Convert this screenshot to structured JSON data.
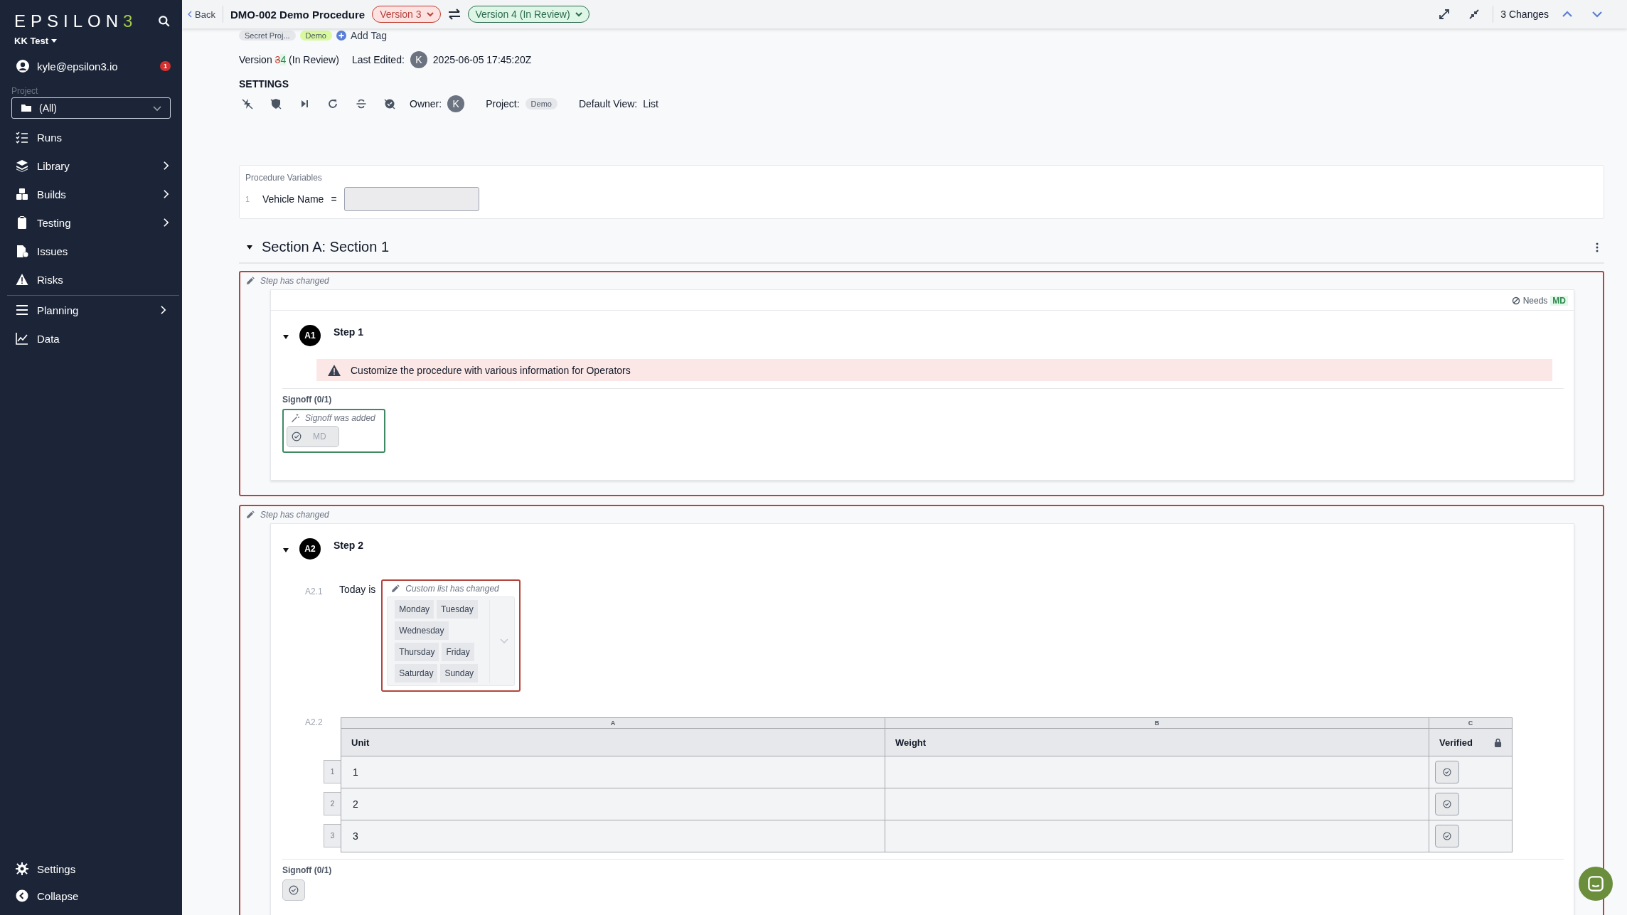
{
  "sidebar": {
    "logo": "EPSILON3",
    "workspace": "KK Test",
    "user": "kyle@epsilon3.io",
    "notifications": "1",
    "project_label": "Project",
    "project_value": "(All)",
    "nav": [
      {
        "label": "Runs",
        "submenu": false,
        "divider_before": false
      },
      {
        "label": "Library",
        "submenu": true,
        "divider_before": false
      },
      {
        "label": "Builds",
        "submenu": true,
        "divider_before": false
      },
      {
        "label": "Testing",
        "submenu": true,
        "divider_before": false
      },
      {
        "label": "Issues",
        "submenu": false,
        "divider_before": false
      },
      {
        "label": "Risks",
        "submenu": false,
        "divider_before": false
      },
      {
        "label": "Planning",
        "submenu": true,
        "divider_before": true
      },
      {
        "label": "Data",
        "submenu": false,
        "divider_before": false
      }
    ],
    "footer": [
      {
        "label": "Settings"
      },
      {
        "label": "Collapse"
      }
    ]
  },
  "topbar": {
    "back": "Back",
    "title": "DMO-002 Demo Procedure",
    "version_from": "Version 3",
    "version_to": "Version 4 (In Review)",
    "changes": "3 Changes"
  },
  "header": {
    "tags": [
      {
        "label": "Secret Proj...",
        "color": "#e5e7eb"
      },
      {
        "label": "Demo",
        "color": "#d9f99d"
      }
    ],
    "add_tag": "Add Tag",
    "version": {
      "prefix": "Version",
      "old": "3",
      "new": "4",
      "status": "(In Review)"
    },
    "last_edited_label": "Last Edited:",
    "editor_initial": "K",
    "last_edited": "2025-06-05 17:45:20Z"
  },
  "settings": {
    "title": "SETTINGS",
    "owner_label": "Owner:",
    "owner_initial": "K",
    "project_label": "Project:",
    "project": "Demo",
    "view_label": "Default View:",
    "view": "List"
  },
  "procedure_variables": {
    "title": "Procedure Variables",
    "rows": [
      {
        "index": "1",
        "name": "Vehicle Name",
        "operator": "="
      }
    ]
  },
  "section": {
    "title": "Section A: Section 1",
    "expanded": true
  },
  "steps": [
    {
      "changed": true,
      "change_note": "Step has changed",
      "needs_label": "Needs",
      "needs_role": "MD",
      "badge": "A1",
      "title": "Step 1",
      "expanded": true,
      "blocks": [
        {
          "kind": "warning",
          "text": "Customize the procedure with various information for Operators"
        }
      ],
      "signoff": {
        "title": "Signoff (0/1)",
        "added": true,
        "change_note": "Signoff was added",
        "buttons": [
          {
            "kind": "labeled",
            "label": "MD"
          }
        ]
      }
    },
    {
      "changed": true,
      "change_note": "Step has changed",
      "badge": "A2",
      "title": "Step 2",
      "expanded": true,
      "blocks": [
        {
          "kind": "custom_list",
          "index": "A2.1",
          "label": "Today is",
          "changed": true,
          "change_note": "Custom list has changed",
          "option_rows": [
            [
              "Monday",
              "Tuesday"
            ],
            [
              "Wednesday"
            ],
            [
              "Thursday",
              "Friday"
            ],
            [
              "Saturday",
              "Sunday"
            ]
          ]
        },
        {
          "kind": "table",
          "index": "A2.2",
          "column_letters": [
            "A",
            "B",
            "C"
          ],
          "columns": [
            {
              "label": "Unit",
              "locked": false
            },
            {
              "label": "Weight",
              "locked": false
            },
            {
              "label": "Verified",
              "locked": true
            }
          ],
          "rows": [
            {
              "number": "1",
              "cells": [
                {
                  "kind": "text",
                  "text": "1"
                },
                {
                  "kind": "empty"
                },
                {
                  "kind": "check"
                }
              ]
            },
            {
              "number": "2",
              "cells": [
                {
                  "kind": "text",
                  "text": "2"
                },
                {
                  "kind": "empty"
                },
                {
                  "kind": "check"
                }
              ]
            },
            {
              "number": "3",
              "cells": [
                {
                  "kind": "text",
                  "text": "3"
                },
                {
                  "kind": "empty"
                },
                {
                  "kind": "check"
                }
              ]
            }
          ]
        }
      ],
      "signoff": {
        "title": "Signoff (0/1)",
        "added": false,
        "buttons": [
          {
            "kind": "icon"
          }
        ]
      }
    }
  ]
}
